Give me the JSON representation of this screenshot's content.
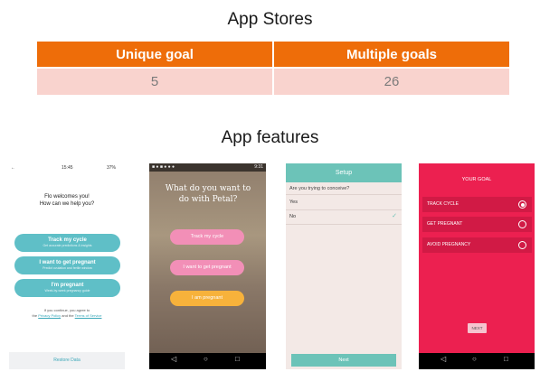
{
  "heading_stores": "App Stores",
  "table": {
    "headers": [
      "Unique goal",
      "Multiple goals"
    ],
    "values": [
      "5",
      "26"
    ]
  },
  "heading_features": "App features",
  "colors": {
    "orange": "#ee6d09",
    "pink_cell": "#f9d3ce",
    "teal": "#5fbfc7",
    "flo_pink": "#ec2050"
  },
  "flo": {
    "time": "15:45",
    "battery": "37%",
    "welcome_line1": "Flo welcomes you!",
    "welcome_line2": "How can we help you?",
    "buttons": [
      {
        "label": "Track my cycle",
        "sub": "Get accurate predictions & insights"
      },
      {
        "label": "I want to get pregnant",
        "sub": "Predict ovulation and fertile window"
      },
      {
        "label": "I'm pregnant",
        "sub": "Week-by-week pregnancy guide"
      }
    ],
    "agree_line1": "If you continue, you agree to",
    "agree_line2_a": "the",
    "privacy": "Privacy Policy",
    "agree_line2_b": "and the",
    "terms": "Terms of Service",
    "restore": "Restore Data"
  },
  "petal": {
    "time": "9:31",
    "question": "What do you want to do with Petal?",
    "buttons": [
      "Track my cycle",
      "I want to get pregnant",
      "I am pregnant"
    ]
  },
  "setup": {
    "title": "Setup",
    "question": "Are you trying to conceive?",
    "options": [
      "Yes",
      "No"
    ],
    "next": "Next"
  },
  "goal": {
    "title": "YOUR GOAL",
    "options": [
      "TRACK CYCLE",
      "GET PREGNANT",
      "AVOID PREGNANCY"
    ],
    "next": "NEXT"
  }
}
